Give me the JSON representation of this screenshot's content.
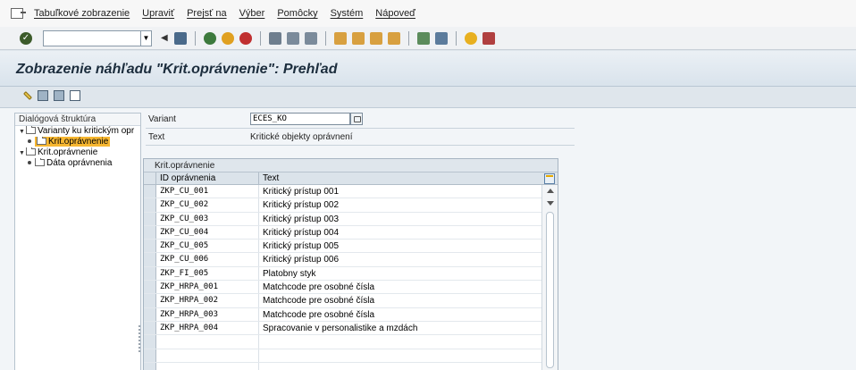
{
  "menubar": {
    "items": [
      "Tabuľkové zobrazenie",
      "Upraviť",
      "Prejsť na",
      "Výber",
      "Pomôcky",
      "Systém",
      "Nápoveď"
    ]
  },
  "title": "Zobrazenie náhľadu \"Krit.oprávnenie\": Prehľad",
  "tree": {
    "header": "Dialógová štruktúra",
    "nodes": [
      {
        "label": "Varianty ku kritickým opr",
        "level": 0,
        "toggle": "▼",
        "selected": false
      },
      {
        "label": "Krit.oprávnenie",
        "level": 1,
        "toggle": "",
        "selected": true
      },
      {
        "label": "Krit.oprávnenie",
        "level": 0,
        "toggle": "▼",
        "selected": false
      },
      {
        "label": "Dáta oprávnenia",
        "level": 1,
        "toggle": "",
        "selected": false
      }
    ]
  },
  "fields": {
    "variant_label": "Variant",
    "variant_value": "ECES_KO",
    "text_label": "Text",
    "text_value": "Kritické objekty oprávnení"
  },
  "table": {
    "title": "Krit.oprávnenie",
    "headers": [
      "ID oprávnenia",
      "Text"
    ],
    "rows": [
      [
        "ZKP_CU_001",
        "Kritický prístup 001"
      ],
      [
        "ZKP_CU_002",
        "Kritický prístup 002"
      ],
      [
        "ZKP_CU_003",
        "Kritický prístup 003"
      ],
      [
        "ZKP_CU_004",
        "Kritický prístup 004"
      ],
      [
        "ZKP_CU_005",
        "Kritický prístup 005"
      ],
      [
        "ZKP_CU_006",
        "Kritický prístup 006"
      ],
      [
        "ZKP_FI_005",
        "Platobny styk"
      ],
      [
        "ZKP_HRPA_001",
        "Matchcode pre osobné čísla"
      ],
      [
        "ZKP_HRPA_002",
        "Matchcode pre osobné čísla"
      ],
      [
        "ZKP_HRPA_003",
        "Matchcode pre osobné čísla"
      ],
      [
        "ZKP_HRPA_004",
        "Spracovanie v personalistike a mzdách"
      ],
      [
        "",
        ""
      ],
      [
        "",
        ""
      ],
      [
        "",
        ""
      ]
    ]
  },
  "colors": {
    "selected_node": "#f7b731",
    "title_text": "#1c2d3d"
  }
}
